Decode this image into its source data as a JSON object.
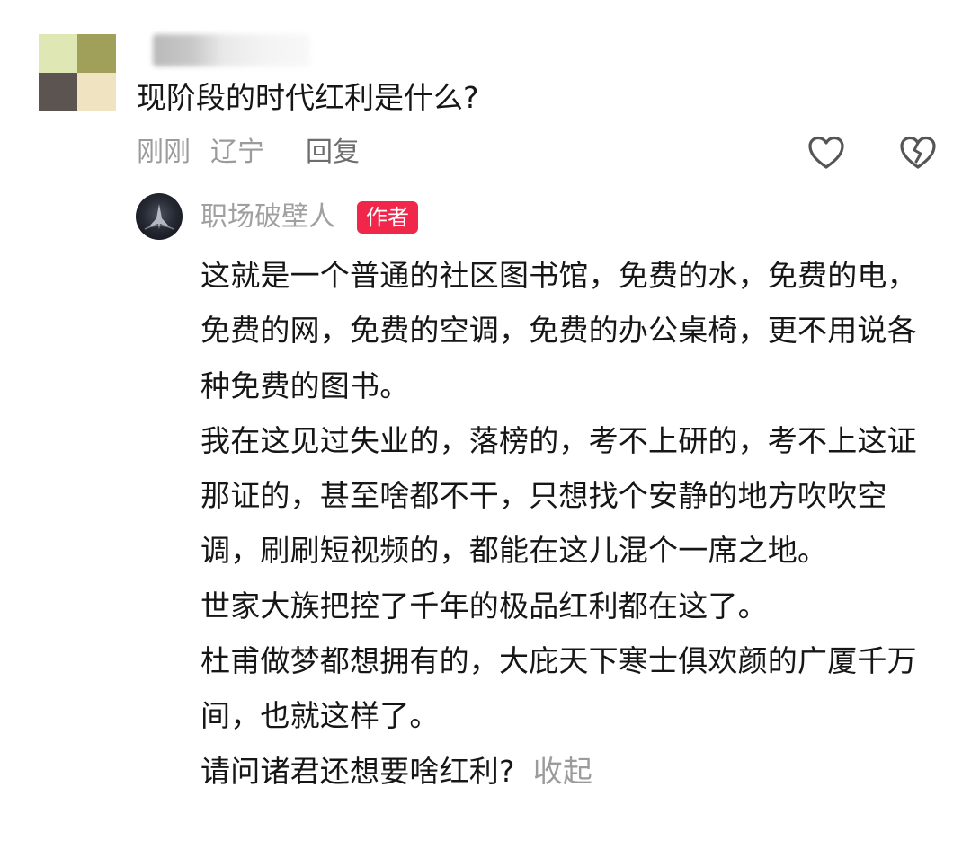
{
  "comment": {
    "avatar_colors": [
      "#dfe8b4",
      "#a0a05a",
      "#5c5451",
      "#efe3c2"
    ],
    "question": "现阶段的时代红利是什么?",
    "time": "刚刚",
    "location": "辽宁",
    "reply_label": "回复",
    "like_icon": "heart-icon",
    "dislike_icon": "broken-heart-icon"
  },
  "reply": {
    "author_name": "职场破壁人",
    "author_badge": "作者",
    "badge_color": "#f0264a",
    "paragraphs": [
      "这就是一个普通的社区图书馆，免费的水，免费的电，免费的网，免费的空调，免费的办公桌椅，更不用说各种免费的图书。",
      "我在这见过失业的，落榜的，考不上研的，考不上这证那证的，甚至啥都不干，只想找个安静的地方吹吹空调，刷刷短视频的，都能在这儿混个一席之地。",
      "世家大族把控了千年的极品红利都在这了。",
      "杜甫做梦都想拥有的，大庇天下寒士俱欢颜的广厦千万间，也就这样了。",
      "请问诸君还想要啥红利?"
    ],
    "collapse_label": "收起"
  }
}
